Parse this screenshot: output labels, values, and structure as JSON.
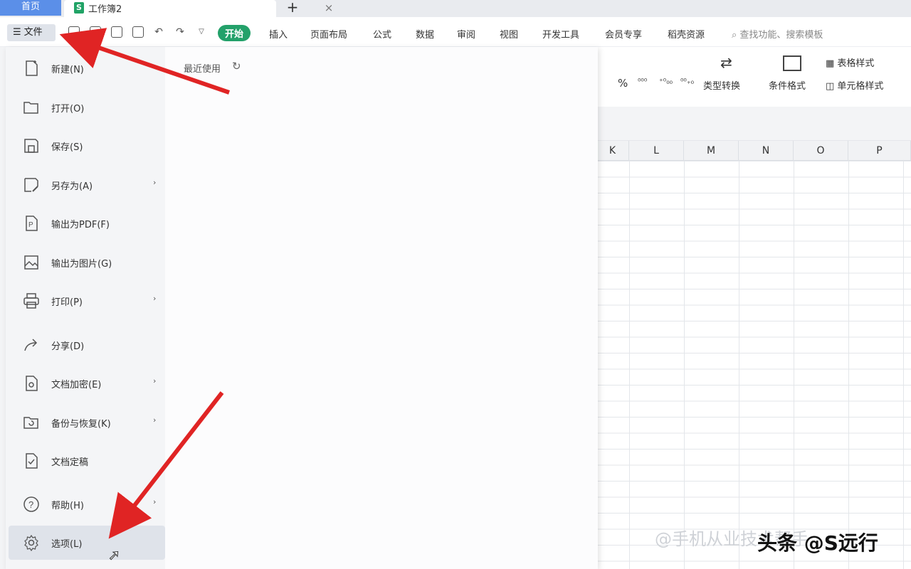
{
  "tabs": {
    "home": "首页",
    "doc_title": "工作簿2",
    "doc_logo": "S",
    "close": "×",
    "add": "+"
  },
  "toolbar": {
    "file_menu": "文件",
    "menus": [
      "开始",
      "插入",
      "页面布局",
      "公式",
      "数据",
      "审阅",
      "视图",
      "开发工具",
      "会员专享",
      "稻壳资源"
    ],
    "active_menu": "开始",
    "search_placeholder": "查找功能、搜索模板"
  },
  "ribbon": {
    "percent": "%",
    "type_convert": "类型转换",
    "conditional_format": "条件格式",
    "table_style": "表格样式",
    "cell_style": "单元格样式"
  },
  "sheet": {
    "columns": [
      "K",
      "L",
      "M",
      "N",
      "O",
      "P"
    ]
  },
  "file_menu": {
    "recent_label": "最近使用",
    "items": [
      {
        "label": "新建(N)",
        "icon": "new-file-icon",
        "arrow": true
      },
      {
        "label": "打开(O)",
        "icon": "folder-open-icon",
        "arrow": false
      },
      {
        "label": "保存(S)",
        "icon": "save-icon",
        "arrow": false
      },
      {
        "label": "另存为(A)",
        "icon": "save-as-icon",
        "arrow": true
      },
      {
        "label": "输出为PDF(F)",
        "icon": "export-pdf-icon",
        "arrow": false
      },
      {
        "label": "输出为图片(G)",
        "icon": "export-image-icon",
        "arrow": false
      },
      {
        "label": "打印(P)",
        "icon": "print-icon",
        "arrow": true
      },
      {
        "label": "分享(D)",
        "icon": "share-icon",
        "arrow": false
      },
      {
        "label": "文档加密(E)",
        "icon": "encrypt-icon",
        "arrow": true
      },
      {
        "label": "备份与恢复(K)",
        "icon": "backup-icon",
        "arrow": true
      },
      {
        "label": "文档定稿",
        "icon": "finalize-icon",
        "arrow": false
      },
      {
        "label": "帮助(H)",
        "icon": "help-icon",
        "arrow": true
      },
      {
        "label": "选项(L)",
        "icon": "settings-icon",
        "arrow": false
      }
    ]
  },
  "watermark": {
    "text": "头条 @S远行",
    "faded": "@手机从业技术帮手"
  },
  "colors": {
    "accent_green": "#23a16a",
    "arrow_red": "#e02424",
    "home_tab_blue": "#5b8fe8"
  }
}
